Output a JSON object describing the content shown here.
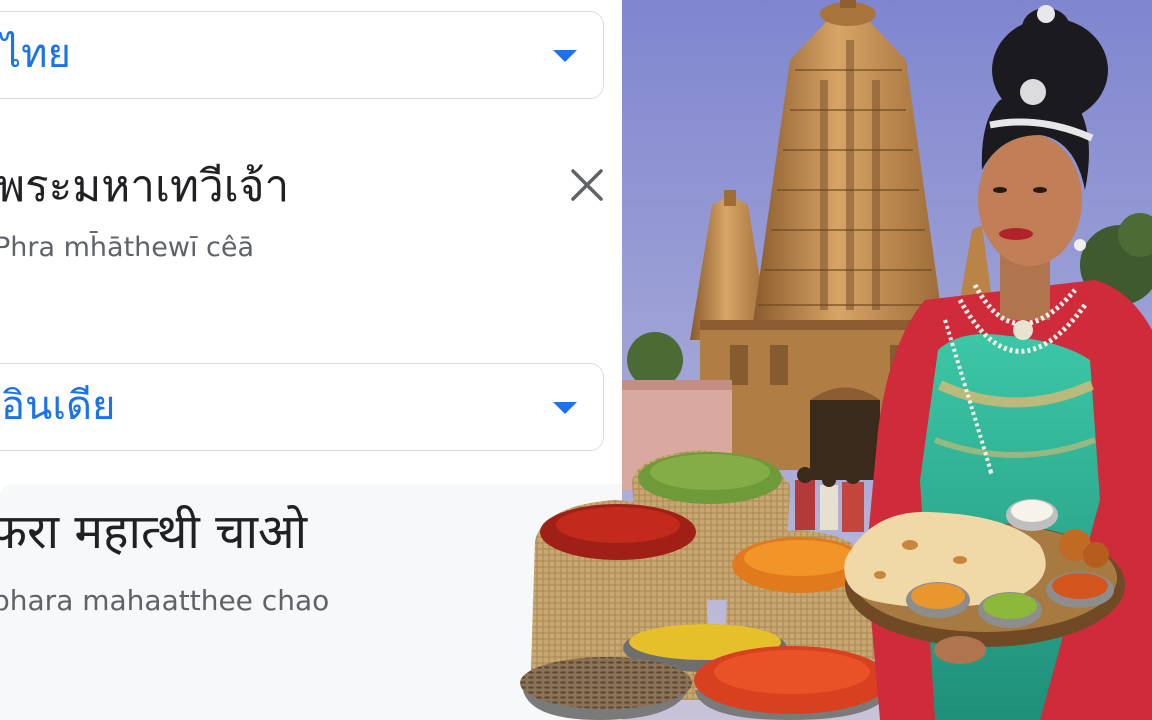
{
  "translator": {
    "source_language": "ไทย",
    "source_text": "พระมหาเทวีเจ้า",
    "source_romanization": "Phra mh̄āthewī cêā",
    "target_language": "อินเดีย",
    "translated_text": "फरा महात्थी चाओ",
    "translated_romanization": "phara mahaatthee chao"
  },
  "icons": {
    "source_dropdown": "chevron-down-icon",
    "target_dropdown": "chevron-down-icon",
    "clear": "close-icon"
  },
  "colors": {
    "accent": "#1a73e8",
    "text_primary": "#202124",
    "text_secondary": "#5f6368",
    "border": "#dadce0",
    "result_bg": "#f7f8fa",
    "sky": "#8a8fd0",
    "temple": "#b8864a",
    "dress": "#2fb89a",
    "sari_red": "#d42d3c"
  }
}
